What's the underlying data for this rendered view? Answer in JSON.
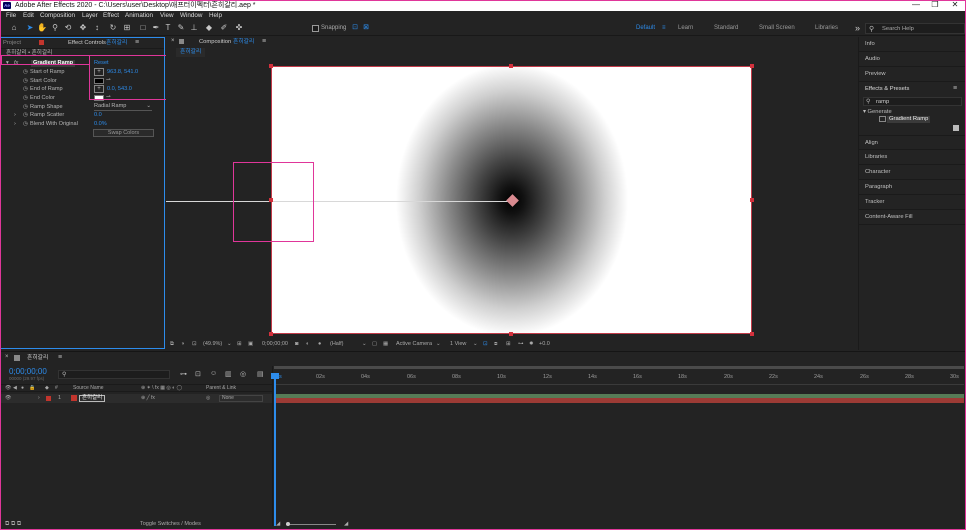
{
  "window": {
    "title": "Adobe After Effects 2020 - C:\\Users\\user\\Desktop\\애프터이펙터\\흔히갈리.aep *",
    "logo": "Ae",
    "minimize": "—",
    "restore": "❐",
    "close": "✕"
  },
  "menu": [
    "File",
    "Edit",
    "Composition",
    "Layer",
    "Effect",
    "Animation",
    "View",
    "Window",
    "Help"
  ],
  "toolbar": {
    "snapping_label": "Snapping",
    "search_help_placeholder": "Search Help",
    "workspaces": [
      "Default",
      "Learn",
      "Standard",
      "Small Screen",
      "Libraries"
    ],
    "active_workspace": "Default",
    "overflow": "»"
  },
  "project_panel": {
    "tab": "Project"
  },
  "effect_controls": {
    "tab_label": "Effect Controls",
    "tab_comp": "흔히갈리",
    "breadcrumb": "흔히갈리 • 흔히갈리",
    "effect_name": "Gradient Ramp",
    "reset": "Reset",
    "fx": "fx",
    "properties": [
      {
        "label": "Start of Ramp",
        "value": "963.8, 541.0"
      },
      {
        "label": "Start Color",
        "value": ""
      },
      {
        "label": "End of Ramp",
        "value": "0.0, 543.0"
      },
      {
        "label": "End Color",
        "value": ""
      },
      {
        "label": "Ramp Shape",
        "value": "Radial Ramp"
      },
      {
        "label": "Ramp Scatter",
        "value": "0.0"
      },
      {
        "label": "Blend With Original",
        "value": "0.0%"
      }
    ],
    "swap_colors": "Swap Colors"
  },
  "composition": {
    "tab_label": "Composition",
    "tab_comp": "흔히갈리",
    "sub_tab": "흔히갈리",
    "zoom": "(49.9%)",
    "timecode": "0;00;00;00",
    "resolution": "(Half)",
    "camera": "Active Camera",
    "views": "1 View",
    "exposure": "+0.0"
  },
  "right_panel": {
    "items_top": [
      "Info",
      "Audio",
      "Preview"
    ],
    "effects_presets": "Effects & Presets",
    "search_value": "ramp",
    "category": "Generate",
    "result": "Gradient Ramp",
    "items_bottom": [
      "Align",
      "Libraries",
      "Character",
      "Paragraph",
      "Tracker",
      "Content-Aware Fill"
    ]
  },
  "timeline": {
    "tab": "흔히갈리",
    "timecode": "0;00;00;00",
    "fps": "00000 (29.97 fps)",
    "col_source_name": "Source Name",
    "col_parent": "Parent & Link",
    "layer_num": "1",
    "layer_name": "흔히갈리",
    "parent_value": "None",
    "ticks": [
      "0s",
      "02s",
      "04s",
      "06s",
      "08s",
      "10s",
      "12s",
      "14s",
      "16s",
      "18s",
      "20s",
      "22s",
      "24s",
      "26s",
      "28s",
      "30s"
    ],
    "toggle": "Toggle Switches / Modes"
  },
  "colors": {
    "accent": "#2d8ceb",
    "highlight_box": "#e0369a",
    "layer_bar": "#9c3b35",
    "selection": "#d3313d"
  }
}
